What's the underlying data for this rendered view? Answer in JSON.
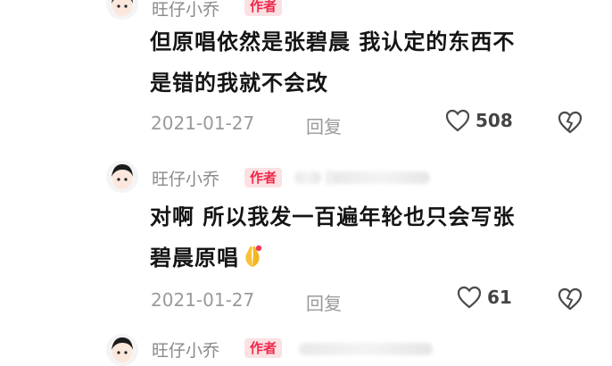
{
  "comments": [
    {
      "username": "旺仔小乔",
      "badge": "作者",
      "text_lines": [
        "但原唱依然是张碧晨 我认定的东西不",
        "是错的我就不会改"
      ],
      "date": "2021-01-27",
      "reply_label": "回复",
      "likes": "508"
    },
    {
      "username": "旺仔小乔",
      "badge": "作者",
      "text_lines": [
        "对啊 所以我发一百遍年轮也只会写张",
        "碧晨原唱"
      ],
      "date": "2021-01-27",
      "reply_label": "回复",
      "likes": "61"
    },
    {
      "username": "旺仔小乔",
      "badge": "作者"
    }
  ],
  "icons": {
    "like": "heart-outline-icon",
    "dislike": "broken-heart-icon",
    "emoji": "praying-hands-emoji"
  },
  "colors": {
    "badge_bg": "#fbe1e3",
    "badge_text": "#f0284a",
    "meta": "#9a9a9a"
  }
}
